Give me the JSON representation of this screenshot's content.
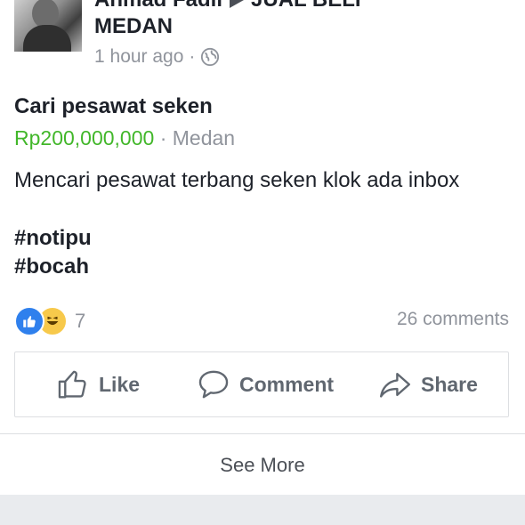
{
  "post": {
    "author": "Ahmad Fadil",
    "group_prefix": "JUAL BELI",
    "group_suffix": "MEDAN",
    "time": "1 hour ago",
    "separator": "·",
    "title": "Cari pesawat seken",
    "price": "Rp200,000,000",
    "location": "Medan",
    "description": "Mencari pesawat terbang seken klok ada inbox",
    "tags": [
      "#notipu",
      "#bocah"
    ],
    "reaction_count": "7",
    "comments": "26 comments"
  },
  "actions": {
    "like": "Like",
    "comment": "Comment",
    "share": "Share"
  },
  "see_more": "See More",
  "icons": {
    "author_arrow": "arrow-right-icon",
    "privacy": "globe-icon",
    "reaction_like": "thumbs-up-icon",
    "reaction_haha": "laughing-face-icon",
    "like": "thumbs-up-outline-icon",
    "comment": "speech-bubble-icon",
    "share": "share-arrow-icon"
  },
  "colors": {
    "price": "#42b72a",
    "like_blue": "#2f80ed",
    "haha_yellow": "#f7c94b",
    "muted": "#90949c"
  }
}
